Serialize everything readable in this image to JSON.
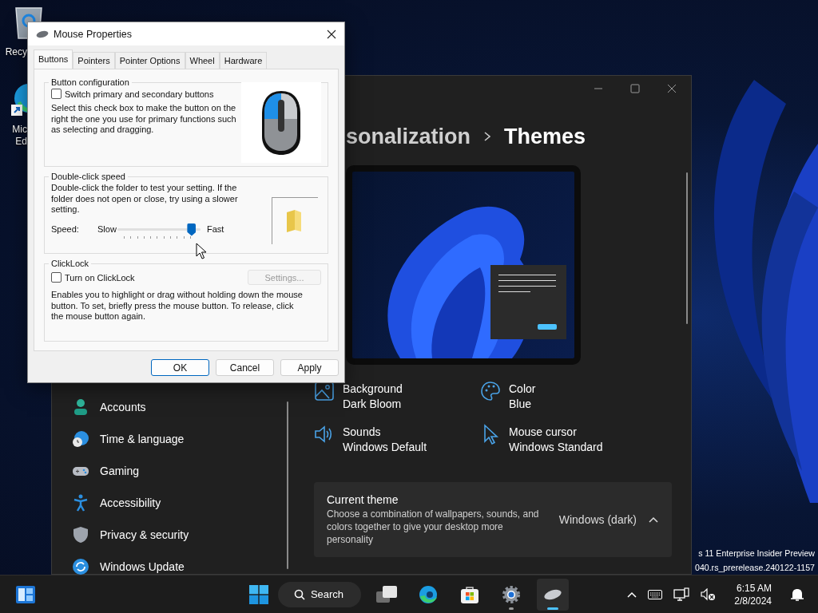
{
  "desktop_icons": [
    {
      "kind": "recycle-bin",
      "lines": [
        "Recy"
      ]
    },
    {
      "kind": "edge-shortcut",
      "lines": [
        "Mic",
        "Ed"
      ]
    }
  ],
  "os_watermark": [
    "s 11 Enterprise Insider Preview",
    "040.rs_prerelease.240122-1157"
  ],
  "settings_window": {
    "breadcrumb_parent": "sonalization",
    "page_title": "Themes",
    "sidebar_items": [
      {
        "kind": "accounts",
        "label": "Accounts"
      },
      {
        "kind": "time",
        "label": "Time & language"
      },
      {
        "kind": "gaming",
        "label": "Gaming"
      },
      {
        "kind": "accessibility",
        "label": "Accessibility"
      },
      {
        "kind": "privacy",
        "label": "Privacy & security"
      },
      {
        "kind": "update",
        "label": "Windows Update"
      }
    ],
    "theme_properties": [
      {
        "kind": "background",
        "label": "Background",
        "value": "Dark Bloom"
      },
      {
        "kind": "color",
        "label": "Color",
        "value": "Blue"
      },
      {
        "kind": "sounds",
        "label": "Sounds",
        "value": "Windows Default"
      },
      {
        "kind": "cursor",
        "label": "Mouse cursor",
        "value": "Windows Standard"
      }
    ],
    "current_theme": {
      "title": "Current theme",
      "description": "Choose a combination of wallpapers, sounds, and colors together to give your desktop more personality",
      "value": "Windows (dark)",
      "expanded": true
    }
  },
  "mouse_dialog": {
    "title": "Mouse Properties",
    "tabs": [
      {
        "label": "Buttons",
        "selected": true
      },
      {
        "label": "Pointers",
        "selected": false
      },
      {
        "label": "Pointer Options",
        "selected": false
      },
      {
        "label": "Wheel",
        "selected": false
      },
      {
        "label": "Hardware",
        "selected": false
      }
    ],
    "button_configuration": {
      "legend": "Button configuration",
      "switch_buttons": {
        "label": "Switch primary and secondary buttons",
        "checked": false
      },
      "description": "Select this check box to make the button on the right the one you use for primary functions such as selecting and dragging."
    },
    "double_click_speed": {
      "legend": "Double-click speed",
      "description": "Double-click the folder to test your setting. If the folder does not open or close, try using a slower setting.",
      "speed_label": "Speed:",
      "slow_label": "Slow",
      "fast_label": "Fast",
      "level": 0.95
    },
    "clicklock": {
      "legend": "ClickLock",
      "toggle": {
        "label": "Turn on ClickLock",
        "checked": false
      },
      "settings_button": {
        "label": "Settings...",
        "disabled": true
      },
      "description": "Enables you to highlight or drag without holding down the mouse button. To set, briefly press the mouse button. To release, click the mouse button again."
    },
    "buttons": [
      {
        "label": "OK",
        "default": true
      },
      {
        "label": "Cancel",
        "default": false
      },
      {
        "label": "Apply",
        "default": false
      }
    ]
  },
  "taskbar": {
    "search_label": "Search",
    "apps": [
      {
        "kind": "task-view",
        "active": false,
        "running": false
      },
      {
        "kind": "edge",
        "active": false,
        "running": false
      },
      {
        "kind": "store",
        "active": false,
        "running": false
      },
      {
        "kind": "settings",
        "active": false,
        "running": true
      },
      {
        "kind": "mouse",
        "active": true,
        "running": true
      }
    ],
    "clock": {
      "time": "6:15 AM",
      "date": "2/8/2024"
    }
  }
}
